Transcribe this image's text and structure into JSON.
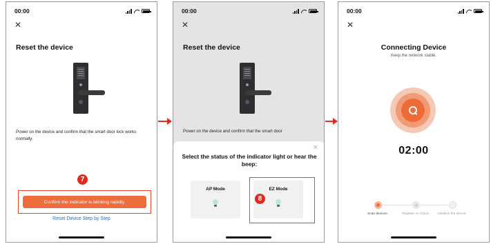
{
  "status_bar": {
    "time": "00:00"
  },
  "screen1": {
    "title": "Reset the device",
    "description": "Power on the device and confirm that the smart door lock works normally.",
    "step_badge": "7",
    "confirm_button": "Confirm the indicator is blinking rapidly.",
    "reset_link": "Reset Device Step by Step"
  },
  "screen2": {
    "title": "Reset the device",
    "description": "Power on the device and confirm that the smart door",
    "sheet_title": "Select the status of the indicator light or hear the beep:",
    "modes": [
      {
        "label": "AP Mode"
      },
      {
        "label": "EZ Mode"
      }
    ],
    "step_badge": "8"
  },
  "screen3": {
    "title": "Connecting Device",
    "subtitle": "Keep the network stable.",
    "timer": "02:00",
    "steps": [
      {
        "label": "Scan devices.",
        "active": true
      },
      {
        "label": "Register on Cloud.",
        "active": false
      },
      {
        "label": "Initialize the device.",
        "active": false
      }
    ]
  },
  "colors": {
    "accent": "#ef6d3d",
    "annotation_red": "#e22b1e",
    "link_blue": "#2f6ec8"
  },
  "icons": [
    "close-icon",
    "signal-icon",
    "wifi-icon",
    "battery-icon",
    "search-icon",
    "bulb-icon"
  ]
}
